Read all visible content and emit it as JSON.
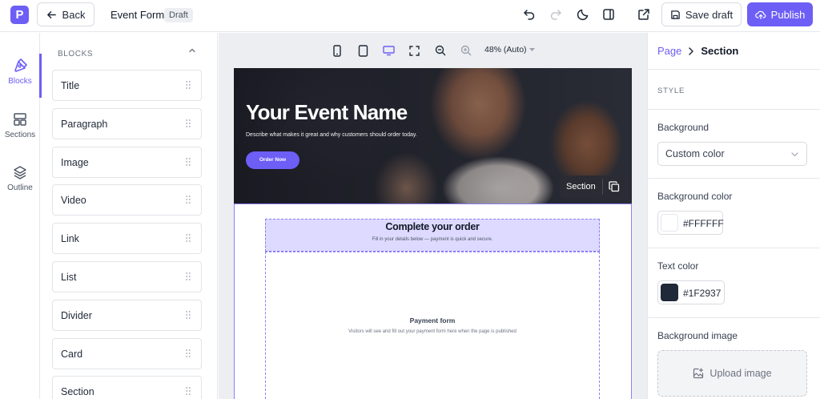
{
  "app": {
    "logo_letter": "P",
    "back_label": "Back",
    "form_title": "Event Form",
    "status_badge": "Draft",
    "save_label": "Save draft",
    "publish_label": "Publish",
    "accent_color": "#6D5EF5"
  },
  "rail": {
    "items": [
      {
        "label": "Blocks",
        "icon": "pen-tool-icon",
        "active": true
      },
      {
        "label": "Sections",
        "icon": "layout-icon",
        "active": false
      },
      {
        "label": "Outline",
        "icon": "layers-icon",
        "active": false
      }
    ]
  },
  "blocks_panel": {
    "header": "BLOCKS",
    "items": [
      "Title",
      "Paragraph",
      "Image",
      "Video",
      "Link",
      "List",
      "Divider",
      "Card",
      "Section"
    ]
  },
  "canvas": {
    "devices": [
      "mobile-icon",
      "tablet-icon",
      "desktop-icon",
      "fullscreen-icon"
    ],
    "active_device": "desktop",
    "zoom_label": "48% (Auto)",
    "hero": {
      "title": "Your Event Name",
      "subtitle": "Describe what makes it great and why customers should order today.",
      "button": "Order Now"
    },
    "section_chip_label": "Section",
    "order": {
      "title": "Complete your order",
      "subtitle": "Fill in your details below — payment is quick and secure."
    },
    "payment": {
      "title": "Payment form",
      "subtitle": "Visitors will see and fill out your payment form here when the page is published"
    }
  },
  "inspector": {
    "breadcrumb_parent": "Page",
    "breadcrumb_current": "Section",
    "style_heading": "STYLE",
    "background_label": "Background",
    "background_value": "Custom color",
    "background_color_label": "Background color",
    "background_color_value": "#FFFFFF",
    "text_color_label": "Text color",
    "text_color_value": "#1F2937",
    "background_image_label": "Background image",
    "upload_label": "Upload image"
  }
}
